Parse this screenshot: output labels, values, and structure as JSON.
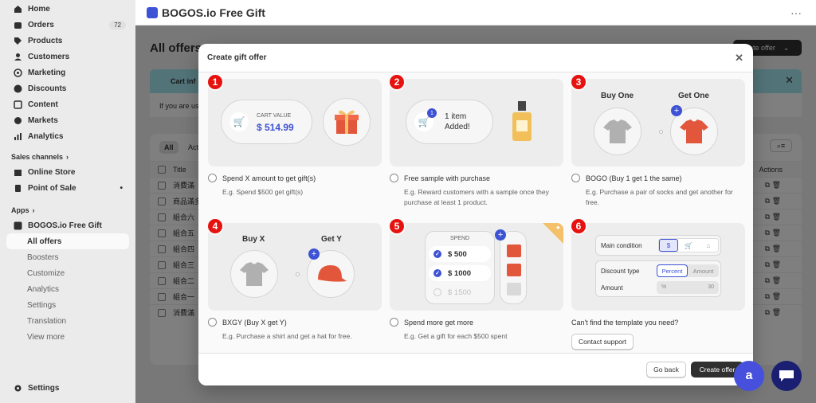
{
  "sidebar": {
    "items": [
      {
        "label": "Home",
        "icon": "home-icon"
      },
      {
        "label": "Orders",
        "icon": "orders-icon",
        "badge": "72"
      },
      {
        "label": "Products",
        "icon": "tag-icon"
      },
      {
        "label": "Customers",
        "icon": "person-icon"
      },
      {
        "label": "Marketing",
        "icon": "target-icon"
      },
      {
        "label": "Discounts",
        "icon": "discount-icon"
      },
      {
        "label": "Content",
        "icon": "content-icon"
      },
      {
        "label": "Markets",
        "icon": "globe-icon"
      },
      {
        "label": "Analytics",
        "icon": "chart-icon"
      }
    ],
    "sales_channels_title": "Sales channels",
    "channels": [
      {
        "label": "Online Store"
      },
      {
        "label": "Point of Sale"
      }
    ],
    "apps_title": "Apps",
    "app": {
      "label": "BOGOS.io Free Gift"
    },
    "app_sub": [
      {
        "label": "All offers"
      },
      {
        "label": "Boosters"
      },
      {
        "label": "Customize"
      },
      {
        "label": "Analytics"
      },
      {
        "label": "Settings"
      },
      {
        "label": "Translation"
      },
      {
        "label": "View more"
      }
    ],
    "settings": "Settings"
  },
  "topbar": {
    "title": "BOGOS.io Free Gift",
    "more": "···"
  },
  "background": {
    "page_title": "All offers",
    "create_btn": "ate offer",
    "banner": "Cart inf",
    "banner_text": "If you are us",
    "tab_all": "All",
    "tab_active": "Acti",
    "col_title": "Title",
    "col_actions": "Actions",
    "rows": [
      "消費滿",
      "商品滿多",
      "組合六",
      "組合五",
      "組合四",
      "組合三",
      "組合二",
      "組合一",
      "消費滿"
    ]
  },
  "modal": {
    "title": "Create gift offer",
    "cards": [
      {
        "num": "1",
        "title": "Spend X amount to get gift(s)",
        "desc": "E.g. Spend $500 get gift(s)",
        "cart_label": "CART VALUE",
        "cart_value": "$ 514.99"
      },
      {
        "num": "2",
        "title": "Free sample with purchase",
        "desc": "E.g. Reward customers with a sample once they purchase at least 1 product.",
        "added_text": "1 item Added!",
        "badge": "1"
      },
      {
        "num": "3",
        "title": "BOGO (Buy 1 get 1 the same)",
        "desc": "E.g. Purchase a pair of socks and get another for free.",
        "left": "Buy One",
        "right": "Get One"
      },
      {
        "num": "4",
        "title": "BXGY (Buy X get Y)",
        "desc": "E.g. Purchase a shirt and get a hat for free.",
        "left": "Buy X",
        "right": "Get Y"
      },
      {
        "num": "5",
        "title": "Spend more get more",
        "desc": "E.g. Get a gift for each $500 spent",
        "spend_label": "SPEND",
        "tiers": [
          "$ 500",
          "$ 1000",
          "$ 1500"
        ]
      },
      {
        "num": "6",
        "main_condition": "Main condition",
        "discount_type": "Discount type",
        "percent": "Percent",
        "amount_tab": "Amount",
        "amount": "Amount",
        "amount_value": "30",
        "amount_unit": "%"
      }
    ],
    "cant_find": "Can't find the template you need?",
    "contact": "Contact support",
    "go_back": "Go back",
    "create": "Create offer"
  },
  "colors": {
    "accent": "#3d52d5",
    "number_badge": "#e5120f",
    "primary_btn": "#303030"
  }
}
